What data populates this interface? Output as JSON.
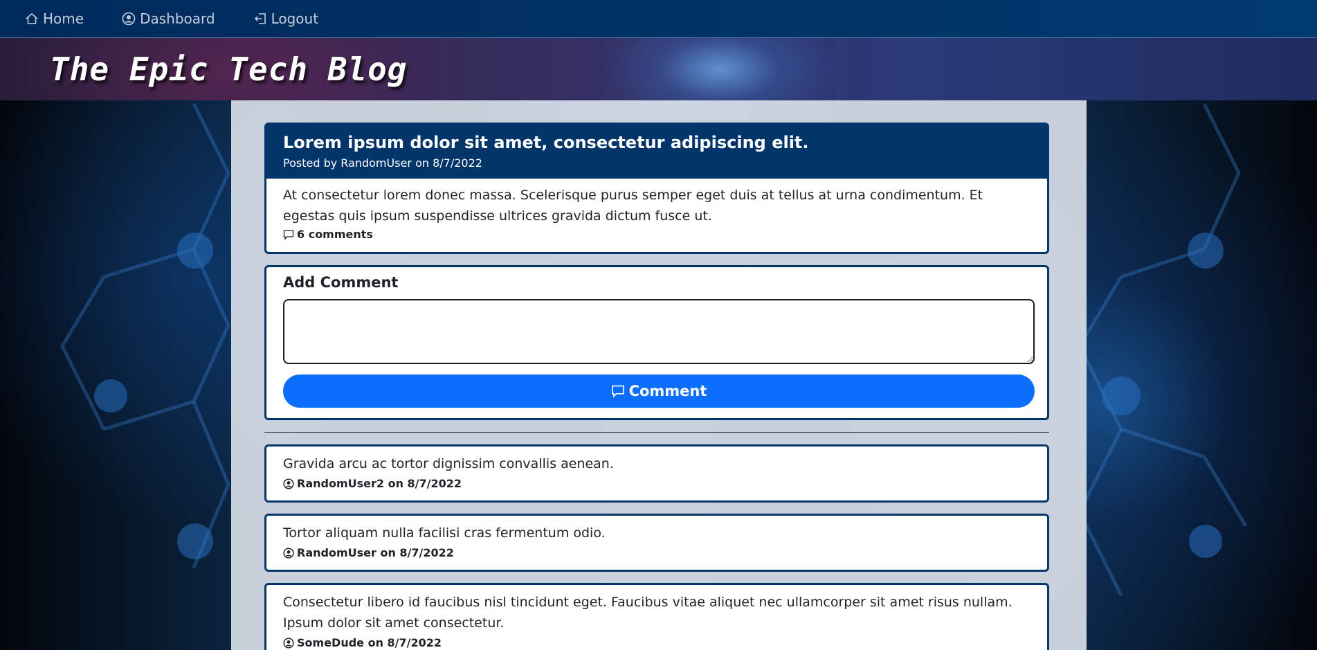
{
  "nav": {
    "items": [
      {
        "label": "Home",
        "icon": "home-icon"
      },
      {
        "label": "Dashboard",
        "icon": "user-circle-icon"
      },
      {
        "label": "Logout",
        "icon": "logout-icon"
      }
    ]
  },
  "banner": {
    "title": "The Epic Tech Blog"
  },
  "post": {
    "title": "Lorem ipsum dolor sit amet, consectetur adipiscing elit.",
    "meta": "Posted by RandomUser on 8/7/2022",
    "body": "At consectetur lorem donec massa. Scelerisque purus semper eget duis at tellus at urna condimentum. Et egestas quis ipsum suspendisse ultrices gravida dictum fusce ut.",
    "comment_count": "6 comments"
  },
  "add_comment": {
    "label": "Add Comment",
    "value": "",
    "button_label": "Comment"
  },
  "comments": [
    {
      "text": "Gravida arcu ac tortor dignissim convallis aenean.",
      "author": "RandomUser2 on 8/7/2022"
    },
    {
      "text": "Tortor aliquam nulla facilisi cras fermentum odio.",
      "author": "RandomUser on 8/7/2022"
    },
    {
      "text": "Consectetur libero id faucibus nisl tincidunt eget. Faucibus vitae aliquet nec ullamcorper sit amet risus nullam. Ipsum dolor sit amet consectetur.",
      "author": "SomeDude on 8/7/2022"
    }
  ],
  "colors": {
    "nav_bg": "#013a70",
    "post_header_bg": "#03356b",
    "card_border": "#04366b",
    "button_bg": "#0d6efd"
  }
}
